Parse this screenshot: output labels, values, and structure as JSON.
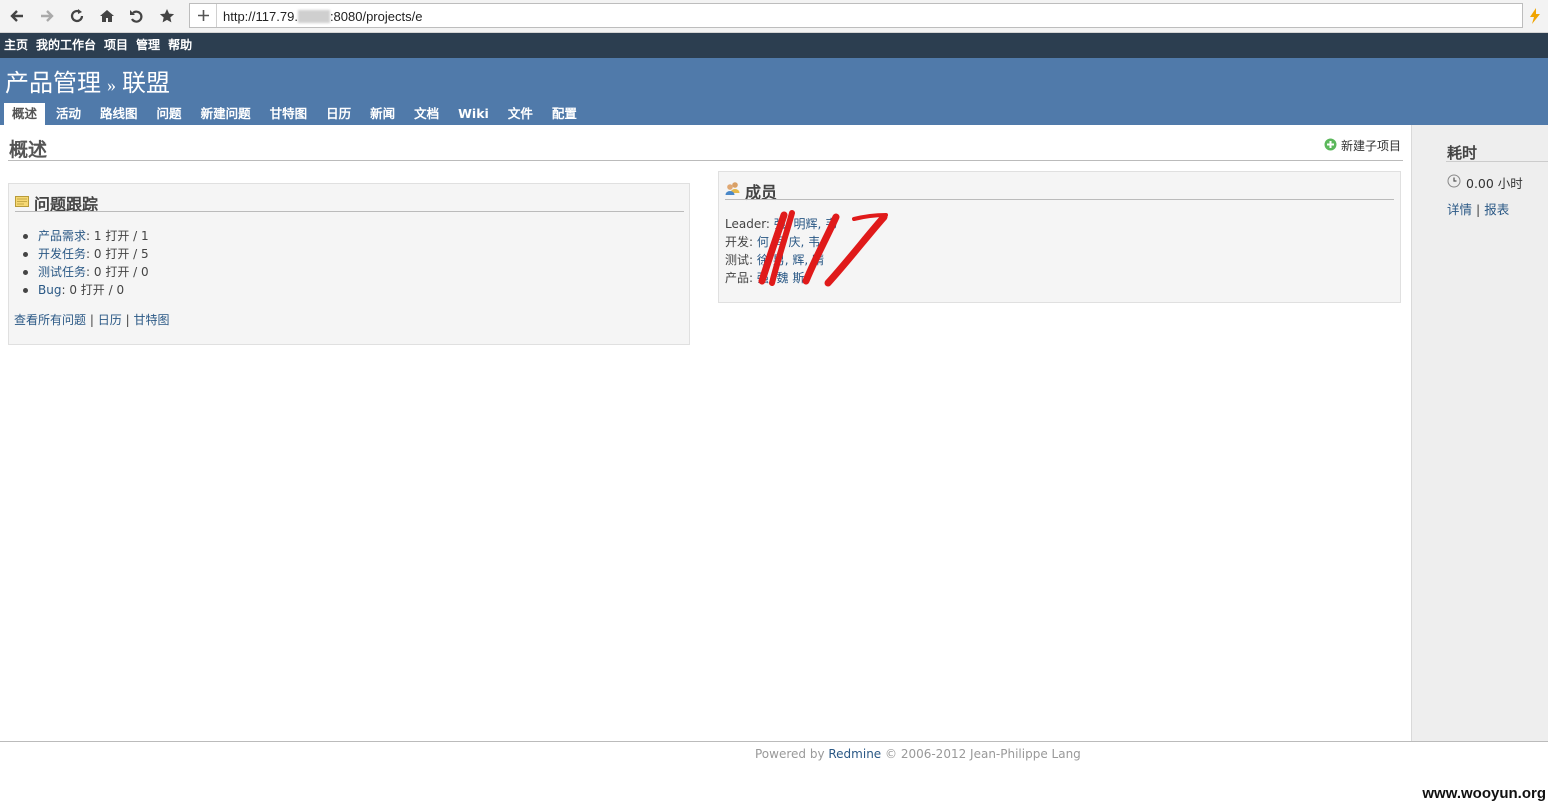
{
  "browser": {
    "url_prefix": "http://117.79.",
    "url_suffix": ":8080/projects/e",
    "icons": [
      "back-arrow-icon",
      "forward-arrow-icon",
      "reload-icon",
      "home-icon",
      "undo-icon",
      "star-icon",
      "plus-icon",
      "lightning-icon"
    ]
  },
  "top_menu": [
    "主页",
    "我的工作台",
    "项目",
    "管理",
    "帮助"
  ],
  "header": {
    "project": "产品管理",
    "separator": "»",
    "subproject": "联盟"
  },
  "tabs": [
    "概述",
    "活动",
    "路线图",
    "问题",
    "新建问题",
    "甘特图",
    "日历",
    "新闻",
    "文档",
    "Wiki",
    "文件",
    "配置"
  ],
  "page": {
    "title": "概述",
    "new_subproject": "新建子项目"
  },
  "issue_tracking": {
    "title": "问题跟踪",
    "items": [
      {
        "tracker": "产品需求",
        "stats": ": 1 打开 / 1"
      },
      {
        "tracker": "开发任务",
        "stats": ": 0 打开 / 5"
      },
      {
        "tracker": "测试任务",
        "stats": ": 0 打开 / 0"
      },
      {
        "tracker": "Bug",
        "stats": ": 0 打开 / 0"
      }
    ],
    "links": [
      "查看所有问题",
      "日历",
      "甘特图"
    ],
    "link_sep": "|"
  },
  "members": {
    "title": "成员",
    "rows": [
      {
        "role": "Leader:",
        "names": "强, 明辉, 韦"
      },
      {
        "role": "开发:",
        "names": "何 闫 庆, 韦"
      },
      {
        "role": "测试:",
        "names": "徐 男, 辉, 晴"
      },
      {
        "role": "产品:",
        "names": "强, 魏 斯"
      }
    ]
  },
  "sidebar": {
    "title": "耗时",
    "hours": "0.00 小时",
    "links": [
      "详情",
      "报表"
    ],
    "link_sep": "|"
  },
  "footer": {
    "prefix": "Powered by ",
    "link": "Redmine",
    "suffix": " © 2006-2012 Jean-Philippe Lang"
  },
  "watermark": "www.wooyun.org",
  "colors": {
    "top_menu_bg": "#2c3e50",
    "header_bg": "#507aaa",
    "link": "#2a5885",
    "annotation": "#e01a1a"
  }
}
